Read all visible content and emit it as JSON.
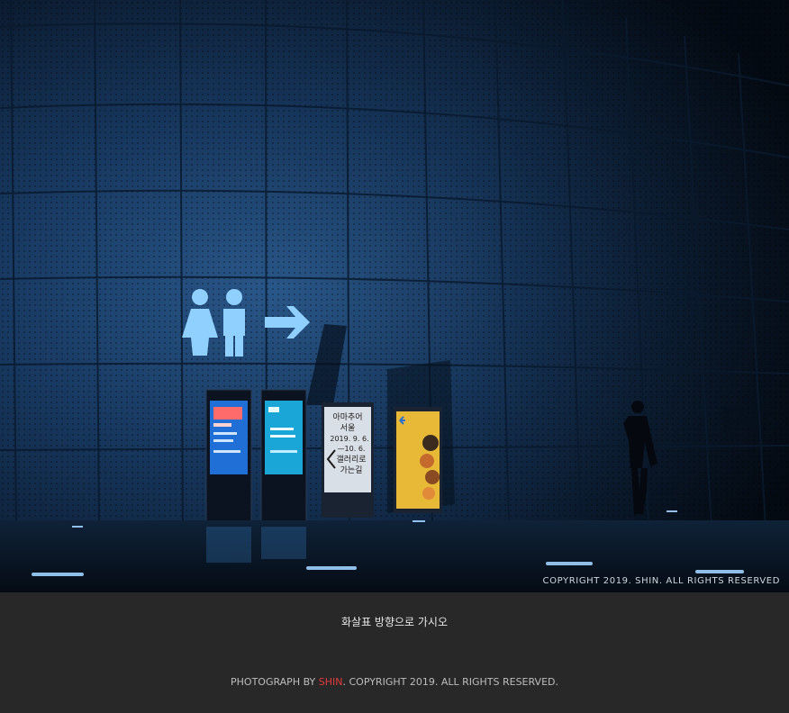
{
  "photo": {
    "alt": "",
    "copyright_overlay": "COPYRIGHT 2019. SHIN. ALL RIGHTS RESERVED",
    "signs": {
      "panel_right_text": [
        "아마추어",
        "서울",
        "2019. 9. 6.",
        "—10. 6.",
        "갤러리로",
        "가는길"
      ]
    }
  },
  "caption": "화살표 방향으로 가시오",
  "credit": {
    "prefix": "PHOTOGRAPH BY ",
    "author": "SHIN",
    "suffix": ". COPYRIGHT 2019. ALL RIGHTS RESERVED."
  },
  "colors": {
    "page_bg": "#282828",
    "accent": "#e53b3b",
    "wall": "#1b3b63",
    "glow": "#6fb7ff"
  }
}
